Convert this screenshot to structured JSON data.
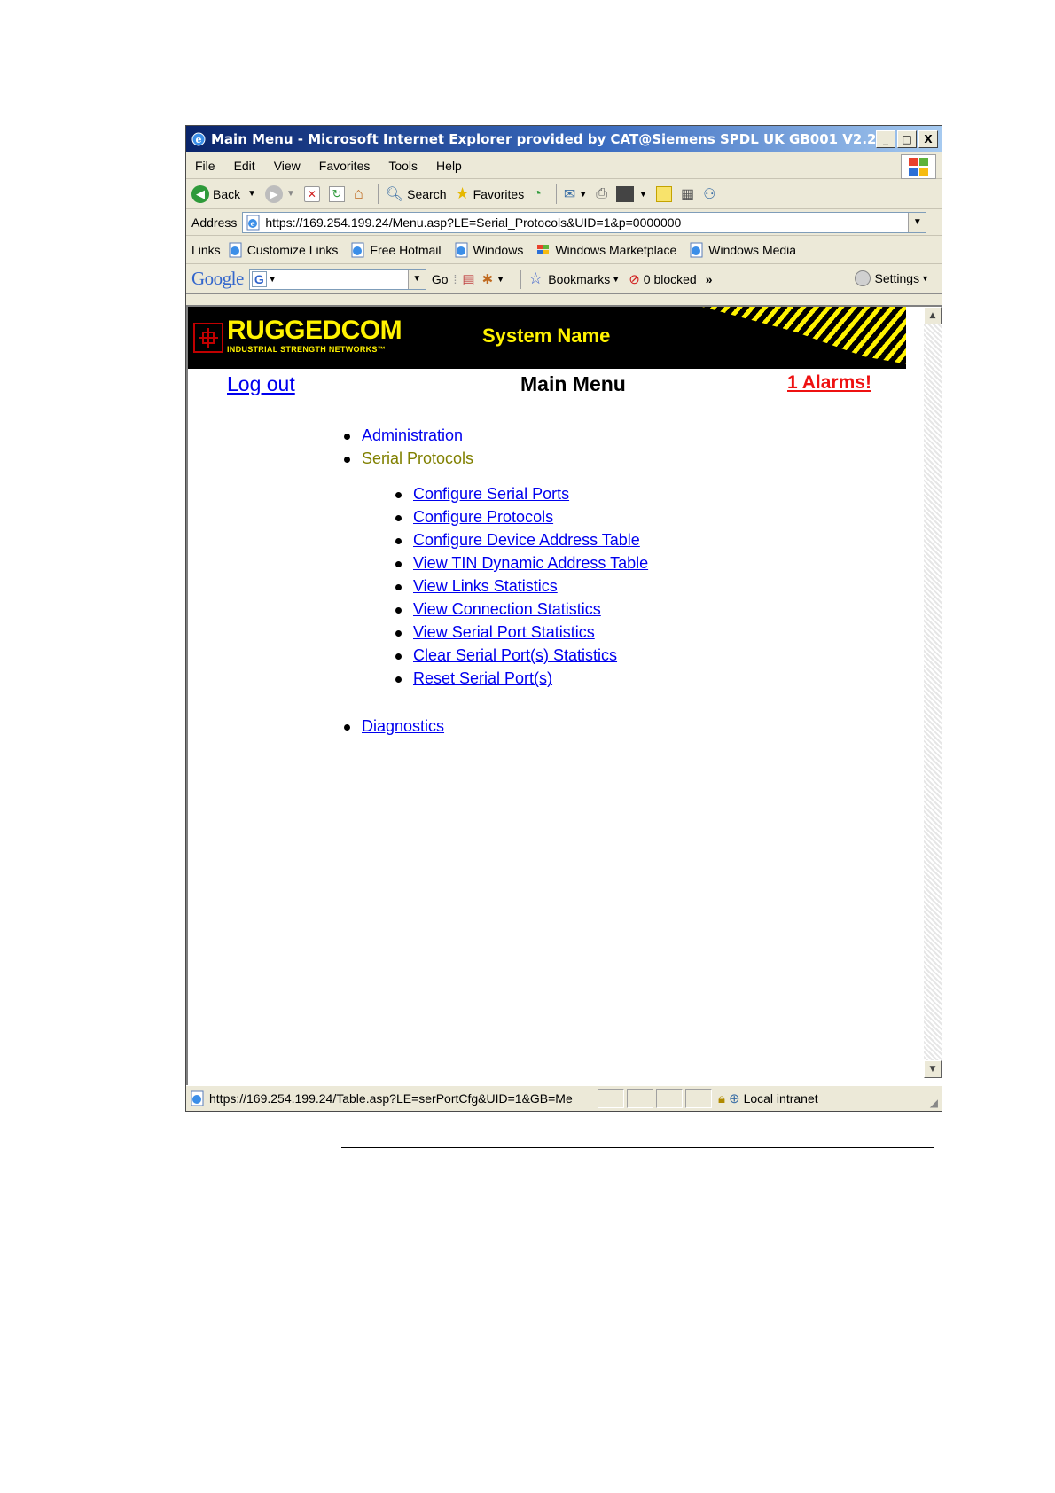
{
  "window": {
    "title": "Main Menu - Microsoft Internet Explorer provided by CAT@Siemens SPDL UK GB001 V2.2",
    "buttons": [
      "_",
      "□",
      "X"
    ]
  },
  "menubar": [
    "File",
    "Edit",
    "View",
    "Favorites",
    "Tools",
    "Help"
  ],
  "toolbar": {
    "back": "Back",
    "search": "Search",
    "favorites": "Favorites"
  },
  "address": {
    "label": "Address",
    "url": "https://169.254.199.24/Menu.asp?LE=Serial_Protocols&UID=1&p=0000000"
  },
  "links": {
    "label": "Links",
    "items": [
      "Customize Links",
      "Free Hotmail",
      "Windows",
      "Windows Marketplace",
      "Windows Media"
    ]
  },
  "google": {
    "logo": "Google",
    "go": "Go",
    "bookmarks": "Bookmarks",
    "blocked": "0 blocked",
    "settings": "Settings"
  },
  "page": {
    "brand": "RUGGEDCOM",
    "brand_sub": "INDUSTRIAL STRENGTH NETWORKS™",
    "system_name": "System Name",
    "logout": "Log out",
    "title": "Main Menu",
    "alarms": "1 Alarms!",
    "menu": [
      "Administration",
      "Serial Protocols"
    ],
    "submenu": [
      "Configure Serial Ports",
      "Configure Protocols",
      "Configure Device Address Table",
      "View TIN Dynamic Address Table",
      "View Links Statistics",
      "View Connection Statistics",
      "View Serial Port Statistics",
      "Clear Serial Port(s) Statistics",
      "Reset Serial Port(s)"
    ],
    "diagnostics": "Diagnostics"
  },
  "status": {
    "url": "https://169.254.199.24/Table.asp?LE=serPortCfg&UID=1&GB=Me",
    "zone": "Local intranet"
  },
  "colors": {
    "link": "#0000ee",
    "visited_link": "#808000",
    "alarm": "#ee1111",
    "brand_yellow": "#fff200"
  }
}
